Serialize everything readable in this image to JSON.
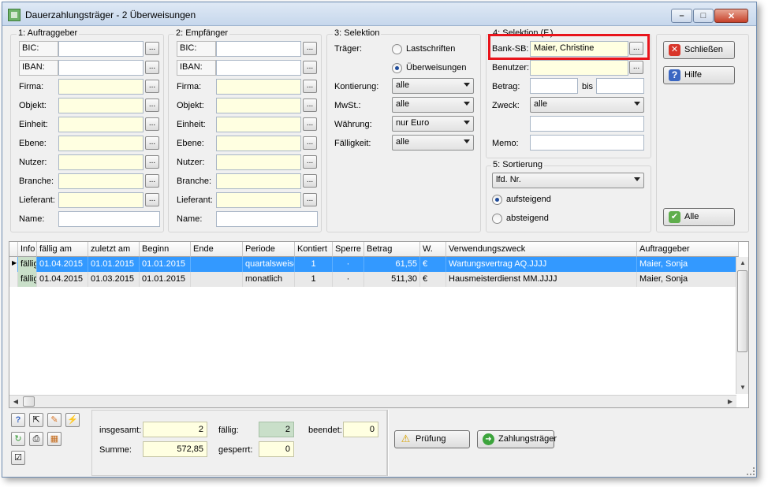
{
  "window": {
    "title": "Dauerzahlungsträger - 2 Überweisungen",
    "controls": {
      "minimize": "–",
      "maximize": "□",
      "close": "✕"
    }
  },
  "auftraggeber": {
    "group_title": "1: Auftraggeber",
    "fields": [
      {
        "label": "BIC:",
        "value": "",
        "dots": "..."
      },
      {
        "label": "IBAN:",
        "value": "",
        "dots": "..."
      },
      {
        "label": "Firma:",
        "value": "",
        "dots": "..."
      },
      {
        "label": "Objekt:",
        "value": "",
        "dots": "..."
      },
      {
        "label": "Einheit:",
        "value": "",
        "dots": "..."
      },
      {
        "label": "Ebene:",
        "value": "",
        "dots": "..."
      },
      {
        "label": "Nutzer:",
        "value": "",
        "dots": "..."
      },
      {
        "label": "Branche:",
        "value": "",
        "dots": "..."
      },
      {
        "label": "Lieferant:",
        "value": "",
        "dots": "..."
      },
      {
        "label": "Name:",
        "value": ""
      }
    ]
  },
  "empfaenger": {
    "group_title": "2: Empfänger",
    "fields": [
      {
        "label": "BIC:",
        "value": "",
        "dots": "..."
      },
      {
        "label": "IBAN:",
        "value": "",
        "dots": "..."
      },
      {
        "label": "Firma:",
        "value": "",
        "dots": "..."
      },
      {
        "label": "Objekt:",
        "value": "",
        "dots": "..."
      },
      {
        "label": "Einheit:",
        "value": "",
        "dots": "..."
      },
      {
        "label": "Ebene:",
        "value": "",
        "dots": "..."
      },
      {
        "label": "Nutzer:",
        "value": "",
        "dots": "..."
      },
      {
        "label": "Branche:",
        "value": "",
        "dots": "..."
      },
      {
        "label": "Lieferant:",
        "value": "",
        "dots": "..."
      },
      {
        "label": "Name:",
        "value": ""
      }
    ]
  },
  "selektion": {
    "group_title": "3: Selektion",
    "traeger_label": "Träger:",
    "radio_lastschriften": "Lastschriften",
    "radio_ueberweisungen": "Überweisungen",
    "selected_traeger": "Überweisungen",
    "kontierung_label": "Kontierung:",
    "kontierung_value": "alle",
    "mwst_label": "MwSt.:",
    "mwst_value": "alle",
    "waehrung_label": "Währung:",
    "waehrung_value": "nur Euro",
    "faelligkeit_label": "Fälligkeit:",
    "faelligkeit_value": "alle"
  },
  "selektion_f": {
    "group_title": "4: Selektion (F.)",
    "bank_sb_label": "Bank-SB:",
    "bank_sb_value": "Maier, Christine",
    "benutzer_label": "Benutzer:",
    "benutzer_value": "",
    "betrag_label": "Betrag:",
    "betrag_from": "",
    "betrag_bis_label": "bis",
    "betrag_to": "",
    "zweck_label": "Zweck:",
    "zweck_value": "alle",
    "zweck_text": "",
    "memo_label": "Memo:",
    "memo_value": "",
    "dots": "..."
  },
  "sortierung": {
    "group_title": "5: Sortierung",
    "sort_field": "lfd. Nr.",
    "radio_auf": "aufsteigend",
    "radio_ab": "absteigend",
    "selected": "aufsteigend"
  },
  "buttons": {
    "schliessen": "Schließen",
    "hilfe": "Hilfe",
    "alle": "Alle",
    "pruefung": "Prüfung",
    "zahlungstraeger": "Zahlungsträger"
  },
  "table": {
    "columns": [
      "Info",
      "fällig am",
      "zuletzt am",
      "Beginn",
      "Ende",
      "Periode",
      "Kontiert",
      "Sperre",
      "Betrag",
      "W.",
      "Verwendungszweck",
      "Auftraggeber"
    ],
    "rows": [
      {
        "info": "fällig",
        "faellig_am": "01.04.2015",
        "zuletzt_am": "01.01.2015",
        "beginn": "01.01.2015",
        "ende": "",
        "periode": "quartalsweise",
        "kontiert": "1",
        "sperre": "·",
        "betrag": "61,55",
        "waehrung": "€",
        "verwendungszweck": "Wartungsvertrag AQ.JJJJ",
        "auftraggeber": "Maier, Sonja"
      },
      {
        "info": "fällig",
        "faellig_am": "01.04.2015",
        "zuletzt_am": "01.03.2015",
        "beginn": "01.01.2015",
        "ende": "",
        "periode": "monatlich",
        "kontiert": "1",
        "sperre": "·",
        "betrag": "511,30",
        "waehrung": "€",
        "verwendungszweck": "Hausmeisterdienst MM.JJJJ",
        "auftraggeber": "Maier, Sonja"
      }
    ]
  },
  "stats": {
    "insgesamt_label": "insgesamt:",
    "insgesamt_value": "2",
    "summe_label": "Summe:",
    "summe_value": "572,85",
    "faellig_label": "fällig:",
    "faellig_value": "2",
    "gesperrt_label": "gesperrt:",
    "gesperrt_value": "0",
    "beendet_label": "beendet:",
    "beendet_value": "0"
  },
  "colors": {
    "selection": "#3399ff",
    "highlight_border": "#e8141b",
    "yellow_field": "#ffffe1",
    "green_cell": "#c9dfc9"
  }
}
